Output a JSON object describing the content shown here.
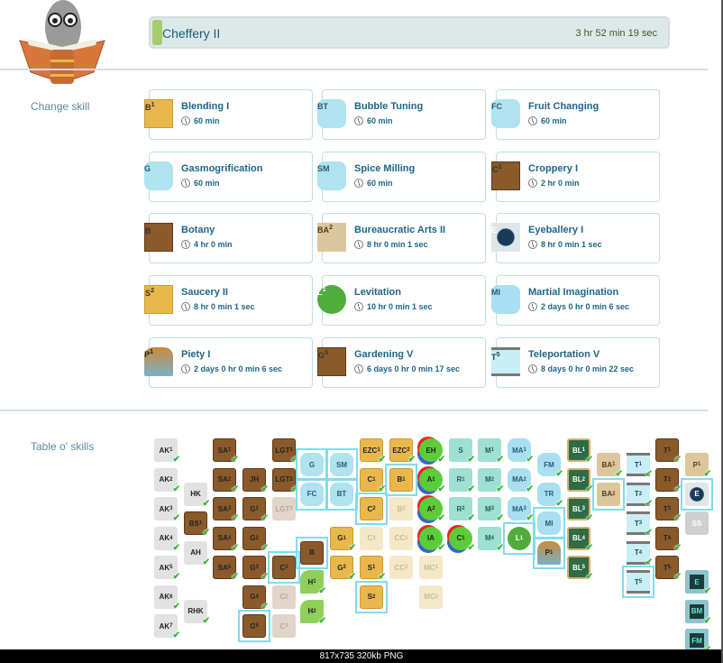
{
  "current": {
    "skill": "Cheffery II",
    "remaining": "3 hr 52 min 19 sec",
    "progress_fraction": 0.02
  },
  "sections": {
    "change_skill": "Change skill",
    "table": "Table o' skills"
  },
  "skills": [
    {
      "name": "Blending I",
      "duration": "60 min",
      "icon": "B",
      "sup": "1",
      "kind": "gold"
    },
    {
      "name": "Bubble Tuning",
      "duration": "60 min",
      "icon": "BT",
      "sup": "",
      "kind": "blue"
    },
    {
      "name": "Fruit Changing",
      "duration": "60 min",
      "icon": "FC",
      "sup": "",
      "kind": "blue"
    },
    {
      "name": "Gasmogrification",
      "duration": "60 min",
      "icon": "G",
      "sup": "",
      "kind": "blue"
    },
    {
      "name": "Spice Milling",
      "duration": "60 min",
      "icon": "SM",
      "sup": "",
      "kind": "blue"
    },
    {
      "name": "Croppery I",
      "duration": "2 hr 0 min",
      "icon": "C",
      "sup": "1",
      "kind": "brown"
    },
    {
      "name": "Botany",
      "duration": "4 hr 0 min",
      "icon": "B",
      "sup": "",
      "kind": "brown"
    },
    {
      "name": "Bureaucratic Arts II",
      "duration": "8 hr 0 min 1 sec",
      "icon": "BA",
      "sup": "2",
      "kind": "scroll"
    },
    {
      "name": "Eyeballery I",
      "duration": "8 hr 0 min 1 sec",
      "icon": "E",
      "sup": "",
      "kind": "eye"
    },
    {
      "name": "Saucery II",
      "duration": "8 hr 0 min 1 sec",
      "icon": "S",
      "sup": "2",
      "kind": "gold"
    },
    {
      "name": "Levitation",
      "duration": "10 hr 0 min 1 sec",
      "icon": "L",
      "sup": "1",
      "kind": "balloon"
    },
    {
      "name": "Martial Imagination",
      "duration": "2 days 0 hr 0 min 6 sec",
      "icon": "MI",
      "sup": "",
      "kind": "cloud"
    },
    {
      "name": "Piety I",
      "duration": "2 days 0 hr 0 min 6 sec",
      "icon": "P",
      "sup": "1",
      "kind": "window"
    },
    {
      "name": "Gardening V",
      "duration": "6 days 0 hr 0 min 17 sec",
      "icon": "G",
      "sup": "5",
      "kind": "brown"
    },
    {
      "name": "Teleportation V",
      "duration": "8 days 0 hr 0 min 22 sec",
      "icon": "T",
      "sup": "5",
      "kind": "tscroll"
    }
  ],
  "table_columns": [
    [
      {
        "l": "AK",
        "s": "1",
        "k": "gray",
        "d": true
      },
      {
        "l": "AK",
        "s": "2",
        "k": "gray",
        "d": true
      },
      {
        "l": "AK",
        "s": "3",
        "k": "gray",
        "d": true
      },
      {
        "l": "AK",
        "s": "4",
        "k": "gray",
        "d": true
      },
      {
        "l": "AK",
        "s": "5",
        "k": "gray",
        "d": true
      },
      {
        "l": "AK",
        "s": "6",
        "k": "gray",
        "d": true
      },
      {
        "l": "AK",
        "s": "7",
        "k": "gray",
        "d": true
      }
    ],
    [
      {
        "l": "HK",
        "s": "",
        "k": "gray",
        "d": true
      },
      {
        "l": "BS",
        "s": "1",
        "k": "brown",
        "d": true
      },
      {
        "l": "AH",
        "s": "",
        "k": "gray",
        "d": true
      },
      {
        "l": "RHK",
        "s": "",
        "k": "gray",
        "d": true
      }
    ],
    [
      {
        "l": "SA",
        "s": "1",
        "k": "brown",
        "d": true
      },
      {
        "l": "SA",
        "s": "2",
        "k": "brown",
        "d": true
      },
      {
        "l": "SA",
        "s": "3",
        "k": "brown",
        "d": true
      },
      {
        "l": "SA",
        "s": "4",
        "k": "brown",
        "d": true
      },
      {
        "l": "SA",
        "s": "5",
        "k": "brown",
        "d": true
      }
    ],
    [
      {
        "l": "JH",
        "s": "",
        "k": "brown",
        "d": true
      },
      {
        "l": "G",
        "s": "1",
        "k": "brown",
        "d": true
      },
      {
        "l": "G",
        "s": "2",
        "k": "brown",
        "d": true
      },
      {
        "l": "G",
        "s": "3",
        "k": "brown",
        "d": true
      },
      {
        "l": "G",
        "s": "4",
        "k": "brown",
        "d": true
      },
      {
        "l": "G",
        "s": "5",
        "k": "brown",
        "d": false,
        "sel": true
      }
    ],
    [
      {
        "l": "LGT",
        "s": "1",
        "k": "brown",
        "d": true
      },
      {
        "l": "LGT",
        "s": "2",
        "k": "brown",
        "d": true
      },
      {
        "l": "LGT",
        "s": "3",
        "k": "brownlock",
        "d": false
      },
      {
        "l": "C",
        "s": "1",
        "k": "brown",
        "d": false,
        "sel": true
      },
      {
        "l": "C",
        "s": "2",
        "k": "brownlock",
        "d": false
      },
      {
        "l": "C",
        "s": "3",
        "k": "brownlock",
        "d": false
      }
    ],
    [
      {
        "l": "G",
        "s": "",
        "k": "blue",
        "d": false,
        "sel": true
      },
      {
        "l": "FC",
        "s": "",
        "k": "blue",
        "d": false,
        "sel": true
      },
      {
        "l": "B",
        "s": "",
        "k": "brown",
        "d": false,
        "sel": true
      },
      {
        "l": "H",
        "s": "1",
        "k": "leaf",
        "d": true
      },
      {
        "l": "H",
        "s": "2",
        "k": "leaf",
        "d": true
      }
    ],
    [
      {
        "l": "SM",
        "s": "",
        "k": "blue",
        "d": false,
        "sel": true
      },
      {
        "l": "BT",
        "s": "",
        "k": "blue",
        "d": false,
        "sel": true
      },
      {
        "l": "G",
        "s": "1",
        "k": "gold",
        "d": true
      },
      {
        "l": "G",
        "s": "2",
        "k": "gold",
        "d": true
      }
    ],
    [
      {
        "l": "EZC",
        "s": "1",
        "k": "gold",
        "d": true
      },
      {
        "l": "C",
        "s": "1",
        "k": "gold",
        "d": true
      },
      {
        "l": "C",
        "s": "2",
        "k": "gold",
        "d": false,
        "sel": true
      },
      {
        "l": "C",
        "s": "3",
        "k": "goldlock",
        "d": false
      },
      {
        "l": "S",
        "s": "1",
        "k": "gold",
        "d": true
      },
      {
        "l": "S",
        "s": "2",
        "k": "gold",
        "d": false,
        "sel": true
      }
    ],
    [
      {
        "l": "EZC",
        "s": "2",
        "k": "gold",
        "d": true
      },
      {
        "l": "B",
        "s": "1",
        "k": "gold",
        "d": false,
        "sel": true
      },
      {
        "l": "B",
        "s": "2",
        "k": "goldlock",
        "d": false
      },
      {
        "l": "CC",
        "s": "1",
        "k": "goldlock",
        "d": false
      },
      {
        "l": "CC",
        "s": "2",
        "k": "goldlock",
        "d": false
      }
    ],
    [
      {
        "l": "EH",
        "s": "",
        "k": "green",
        "d": true
      },
      {
        "l": "A",
        "s": "1",
        "k": "green",
        "d": true
      },
      {
        "l": "A",
        "s": "2",
        "k": "green",
        "d": true
      },
      {
        "l": "IA",
        "s": "",
        "k": "green",
        "d": true
      },
      {
        "l": "MC",
        "s": "1",
        "k": "goldlock",
        "d": false
      },
      {
        "l": "MC",
        "s": "2",
        "k": "goldlock",
        "d": false
      }
    ],
    [
      {
        "l": "S",
        "s": "",
        "k": "teal",
        "d": true
      },
      {
        "l": "R",
        "s": "1",
        "k": "teal",
        "d": true
      },
      {
        "l": "R",
        "s": "2",
        "k": "teal",
        "d": true
      },
      {
        "l": "C",
        "s": "1",
        "k": "green",
        "d": true
      }
    ],
    [
      {
        "l": "M",
        "s": "1",
        "k": "teal",
        "d": true
      },
      {
        "l": "M",
        "s": "2",
        "k": "teal",
        "d": true
      },
      {
        "l": "M",
        "s": "3",
        "k": "teal",
        "d": true
      },
      {
        "l": "M",
        "s": "4",
        "k": "teal",
        "d": true
      }
    ],
    [
      {
        "l": "MA",
        "s": "1",
        "k": "cloud",
        "d": true
      },
      {
        "l": "MA",
        "s": "2",
        "k": "cloud",
        "d": true
      },
      {
        "l": "MA",
        "s": "3",
        "k": "cloud",
        "d": true
      },
      {
        "l": "L",
        "s": "1",
        "k": "balloon",
        "d": false,
        "sel": true
      }
    ],
    [
      {
        "l": "FM",
        "s": "",
        "k": "cloud",
        "d": true
      },
      {
        "l": "TR",
        "s": "",
        "k": "cloud",
        "d": true
      },
      {
        "l": "MI",
        "s": "",
        "k": "cloud",
        "d": false,
        "sel": true
      },
      {
        "l": "P",
        "s": "1",
        "k": "window",
        "d": false,
        "sel": true
      }
    ],
    [
      {
        "l": "BL",
        "s": "1",
        "k": "chalk",
        "d": true
      },
      {
        "l": "BL",
        "s": "2",
        "k": "chalk",
        "d": true
      },
      {
        "l": "BL",
        "s": "3",
        "k": "chalk",
        "d": true
      },
      {
        "l": "BL",
        "s": "4",
        "k": "chalk",
        "d": true
      },
      {
        "l": "BL",
        "s": "5",
        "k": "chalk",
        "d": true
      }
    ],
    [
      {
        "l": "BA",
        "s": "1",
        "k": "scroll",
        "d": true
      },
      {
        "l": "BA",
        "s": "2",
        "k": "scroll",
        "d": false,
        "sel": true
      }
    ],
    [
      {
        "l": "T",
        "s": "1",
        "k": "tscroll",
        "d": true
      },
      {
        "l": "T",
        "s": "2",
        "k": "tscroll",
        "d": true
      },
      {
        "l": "T",
        "s": "3",
        "k": "tscroll",
        "d": true
      },
      {
        "l": "T",
        "s": "4",
        "k": "tscroll",
        "d": true
      },
      {
        "l": "T",
        "s": "5",
        "k": "tscroll",
        "d": false,
        "sel": true
      }
    ],
    [
      {
        "l": "T",
        "s": "1",
        "k": "brown",
        "d": true
      },
      {
        "l": "T",
        "s": "2",
        "k": "brown",
        "d": true
      },
      {
        "l": "T",
        "s": "3",
        "k": "brown",
        "d": true
      },
      {
        "l": "T",
        "s": "4",
        "k": "brown",
        "d": true
      },
      {
        "l": "T",
        "s": "5",
        "k": "brown",
        "d": true
      }
    ],
    [
      {
        "l": "P",
        "s": "1",
        "k": "scroll",
        "d": true
      },
      {
        "l": "E",
        "s": "",
        "k": "eye",
        "d": false,
        "sel": true
      },
      {
        "l": "SS",
        "s": "",
        "k": "camera",
        "d": false
      },
      {
        "l": "E",
        "s": "",
        "k": "screen",
        "d": true
      },
      {
        "l": "BM",
        "s": "",
        "k": "screen",
        "d": true
      },
      {
        "l": "FM",
        "s": "",
        "k": "screen",
        "d": true
      }
    ]
  ],
  "caption": "817x735  320kb  PNG",
  "colors": {
    "accent": "#1d6687",
    "progress": "#a6cc6e",
    "selected": "#7fdcf0",
    "check": "#3cb43c"
  }
}
